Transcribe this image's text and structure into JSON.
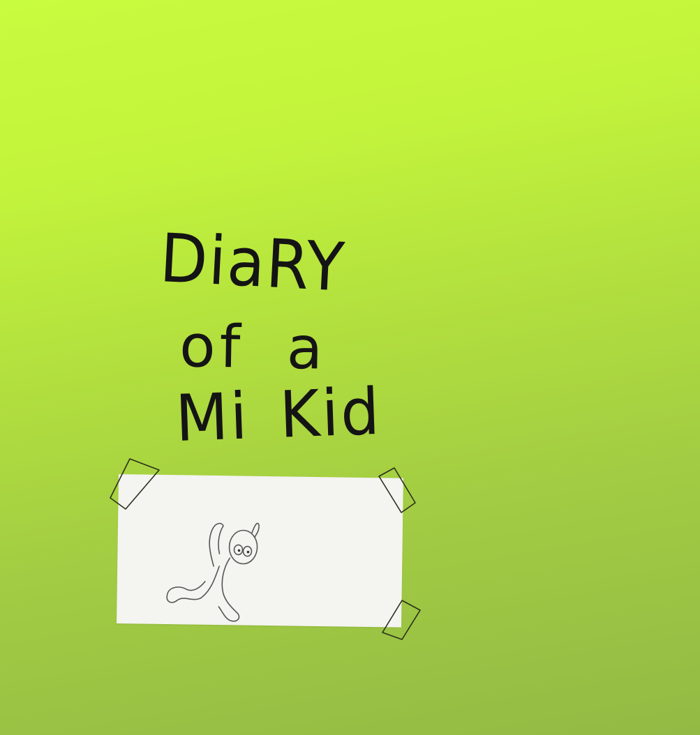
{
  "cover": {
    "title_lines": [
      "DiaRY",
      "of a",
      "Mi Kid"
    ]
  },
  "colors": {
    "background_top": "#c8fc3e",
    "background_bottom": "#93ba44",
    "ink": "#141414",
    "paper": "#f4f4f0"
  },
  "illustration": {
    "subject": "running-stick-figure",
    "icons": [
      "tape-icon",
      "paper-note",
      "stick-figure"
    ]
  }
}
